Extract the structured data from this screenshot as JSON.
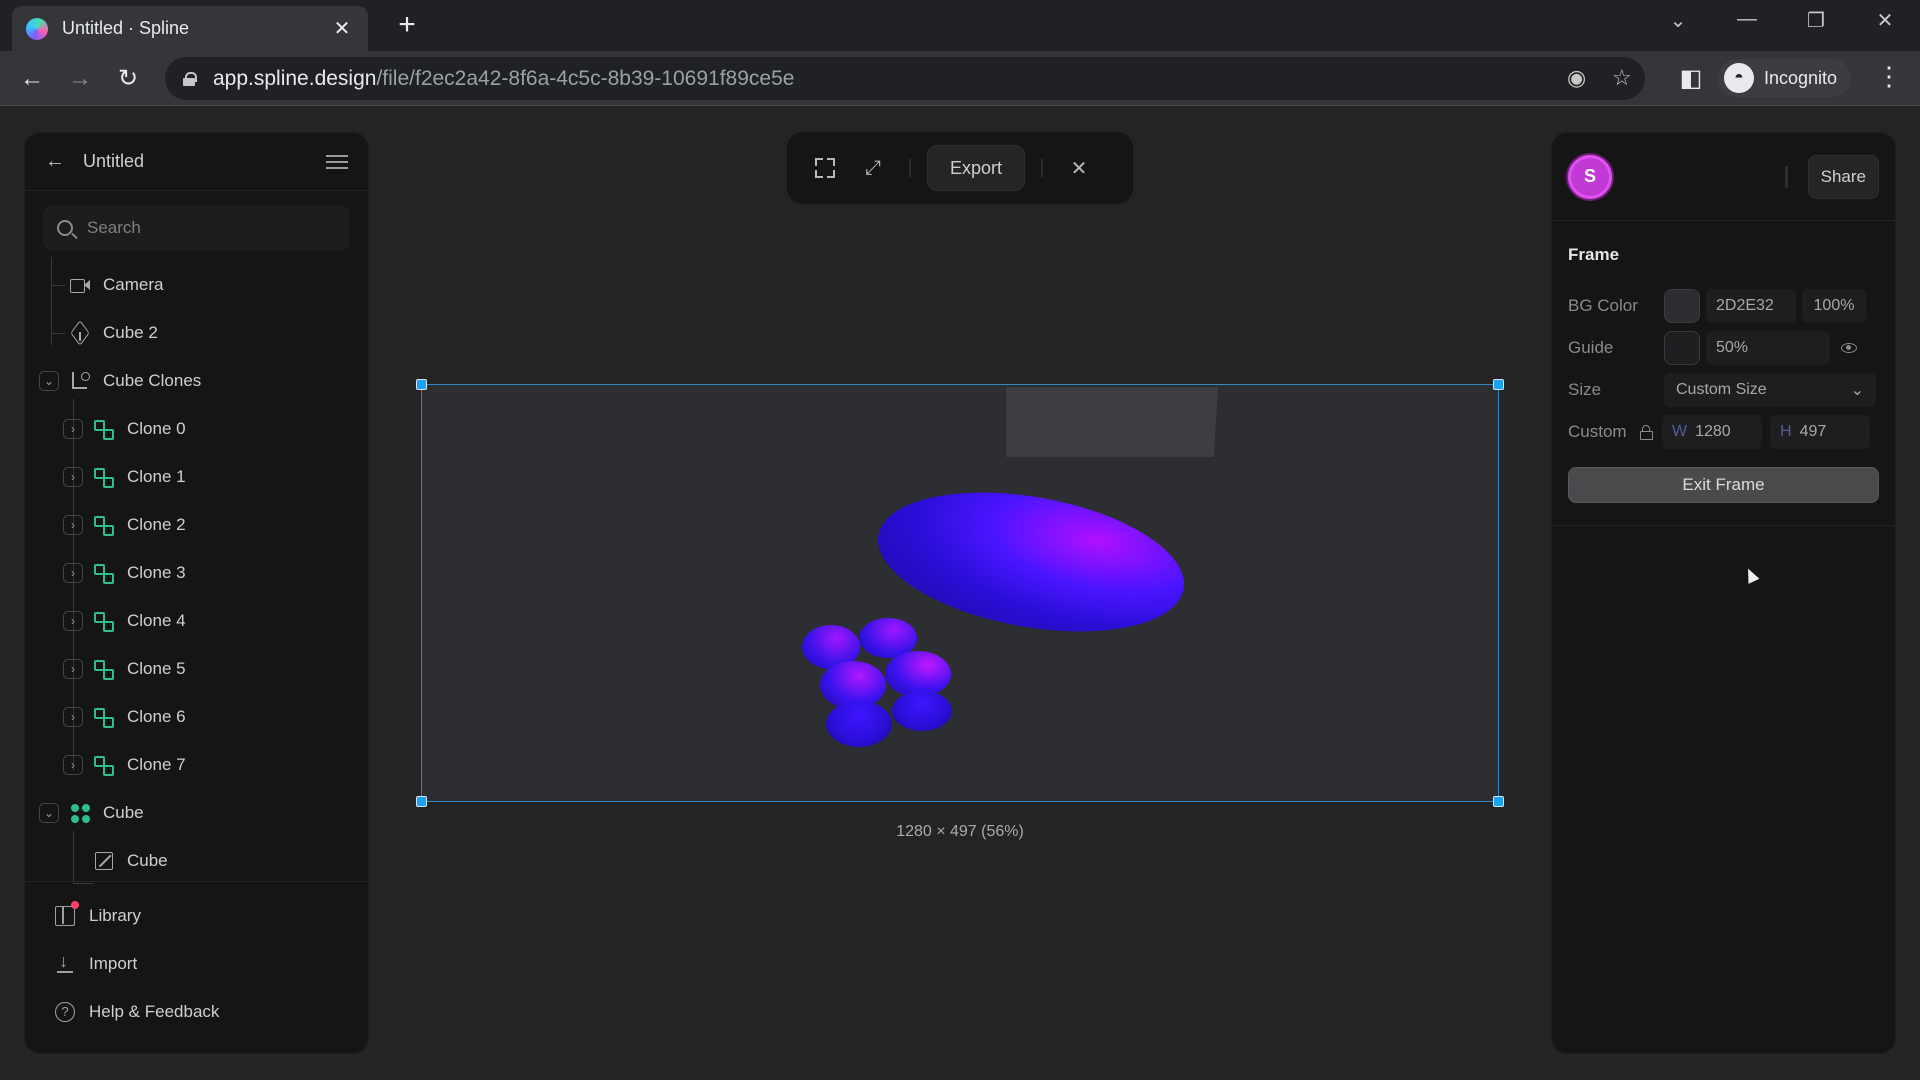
{
  "browser": {
    "tab_title": "Untitled · Spline",
    "tab_close": "✕",
    "new_tab": "+",
    "url_host": "app.spline.design",
    "url_path": "/file/f2ec2a42-8f6a-4c5c-8b39-10691f89ce5e",
    "profile_label": "Incognito",
    "window_controls": {
      "tab_search": "⌄",
      "minimize": "—",
      "restore": "❐",
      "close": "✕"
    },
    "nav": {
      "back": "←",
      "forward": "→",
      "reload": "↻"
    }
  },
  "left_panel": {
    "back_icon": "←",
    "title": "Untitled",
    "search_placeholder": "Search",
    "tree": [
      {
        "label": "Camera",
        "icon": "camera-icon",
        "level": 0
      },
      {
        "label": "Cube 2",
        "icon": "cube-icon",
        "level": 0
      },
      {
        "label": "Cube Clones",
        "icon": "cloner-icon",
        "level": 0,
        "expanded": true
      },
      {
        "label": "Clone 0",
        "icon": "clone-icon",
        "level": 1
      },
      {
        "label": "Clone 1",
        "icon": "clone-icon",
        "level": 1
      },
      {
        "label": "Clone 2",
        "icon": "clone-icon",
        "level": 1
      },
      {
        "label": "Clone 3",
        "icon": "clone-icon",
        "level": 1
      },
      {
        "label": "Clone 4",
        "icon": "clone-icon",
        "level": 1
      },
      {
        "label": "Clone 5",
        "icon": "clone-icon",
        "level": 1
      },
      {
        "label": "Clone 6",
        "icon": "clone-icon",
        "level": 1
      },
      {
        "label": "Clone 7",
        "icon": "clone-icon",
        "level": 1
      },
      {
        "label": "Cube",
        "icon": "group-icon",
        "level": 0,
        "expanded": true
      },
      {
        "label": "Cube",
        "icon": "shape-icon",
        "level": 1
      }
    ],
    "footer": [
      {
        "label": "Library",
        "icon": "library-icon"
      },
      {
        "label": "Import",
        "icon": "import-icon"
      },
      {
        "label": "Help & Feedback",
        "icon": "help-icon"
      }
    ]
  },
  "toolbar": {
    "export_label": "Export",
    "close_icon": "✕",
    "expand_icon": "⤢"
  },
  "canvas": {
    "frame_size_label": "1280 × 497 (56%)"
  },
  "right_panel": {
    "avatar_initial": "S",
    "share_label": "Share",
    "section_title": "Frame",
    "bg_color": {
      "label": "BG Color",
      "hex": "2D2E32",
      "opacity": "100%",
      "swatch": "#2d2e32"
    },
    "guide": {
      "label": "Guide",
      "value": "50%"
    },
    "size": {
      "label": "Size",
      "value": "Custom Size"
    },
    "custom": {
      "label": "Custom",
      "w_prefix": "W",
      "w": "1280",
      "h_prefix": "H",
      "h": "497"
    },
    "exit_frame_label": "Exit Frame"
  },
  "colors": {
    "accent_selection": "#1da1f2",
    "clone_green": "#2fbf8c",
    "avatar_magenta": "#c23ad6"
  }
}
